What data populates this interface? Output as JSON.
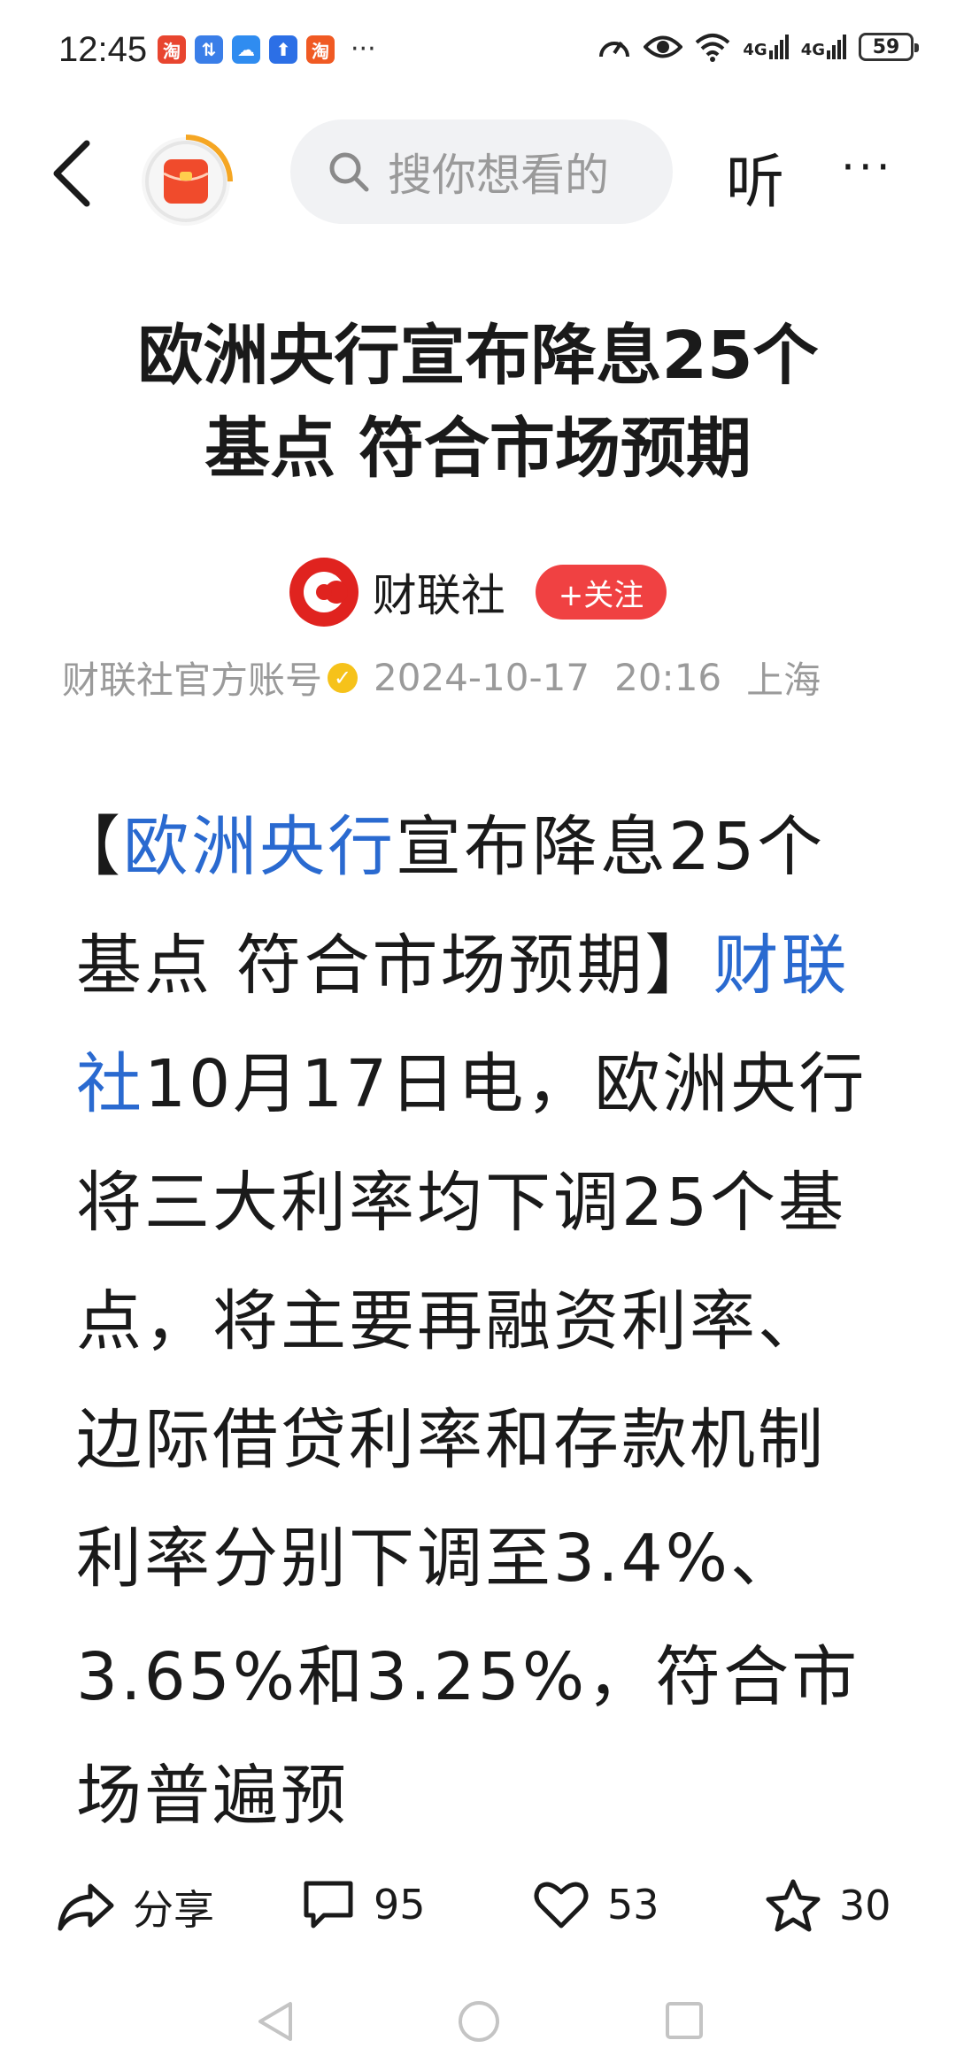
{
  "status_bar": {
    "time": "12:45",
    "app_icons": [
      {
        "name": "taobao-special-icon",
        "glyph": "淘",
        "color": "#e8452f"
      },
      {
        "name": "transfer-app-icon",
        "glyph": "⇅",
        "color": "#3a7ee8"
      },
      {
        "name": "cloud-app-icon",
        "glyph": "☁",
        "color": "#2f8cf0"
      },
      {
        "name": "upload-app-icon",
        "glyph": "⬆",
        "color": "#2c6fe6"
      },
      {
        "name": "taobao-icon",
        "glyph": "淘",
        "color": "#f05a23"
      }
    ],
    "more": "···",
    "network_1": "4G",
    "network_2": "4G",
    "battery": "59"
  },
  "nav": {
    "search_placeholder": "搜你想看的",
    "listen_label": "听",
    "more_label": "···"
  },
  "article": {
    "title_line1": "欧洲央行宣布降息25个",
    "title_line2": "基点 符合市场预期",
    "author": "财联社",
    "follow_label": "+关注",
    "account_label": "财联社官方账号",
    "date": "2024-10-17",
    "time": "20:16",
    "location": "上海",
    "body": {
      "open_bracket": "【",
      "link1": "欧洲央行",
      "headline_rest": "宣布降息25个基点 符合市场预期】",
      "link2": "财联社",
      "text": "10月17日电，欧洲央行将三大利率均下调25个基点，将主要再融资利率、边际借贷利率和存款机制利率分别下调至3.4%、3.65%和3.25%，符合市场普遍预"
    }
  },
  "actions": {
    "share_label": "分享",
    "comments": "95",
    "likes": "53",
    "favorites": "30"
  },
  "colors": {
    "accent_red": "#f04142",
    "link_blue": "#2a6ad0"
  }
}
